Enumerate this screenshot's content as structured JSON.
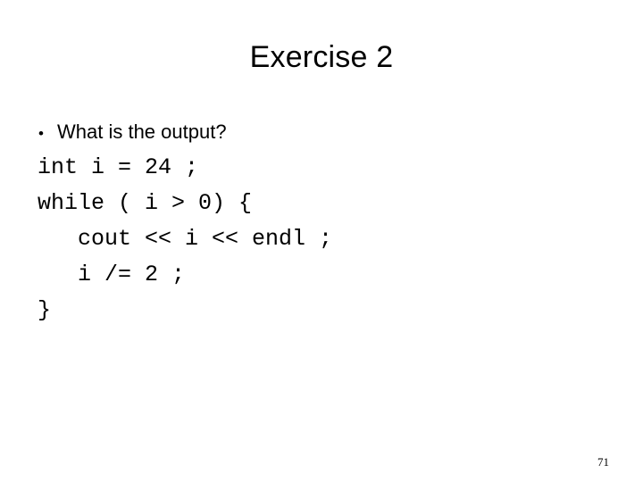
{
  "slide": {
    "title": "Exercise 2",
    "page_number": "71",
    "background_color": "#ffffff",
    "text_color": "#000000"
  },
  "content": {
    "bullet": {
      "marker": "•",
      "text": "What is the output?"
    },
    "code_lines": [
      {
        "text": "int i = 24 ;"
      },
      {
        "text": "while ( i > 0) {"
      },
      {
        "text": "   cout << i << endl ;"
      },
      {
        "text": "   i /= 2 ;"
      },
      {
        "text": "}"
      }
    ]
  }
}
